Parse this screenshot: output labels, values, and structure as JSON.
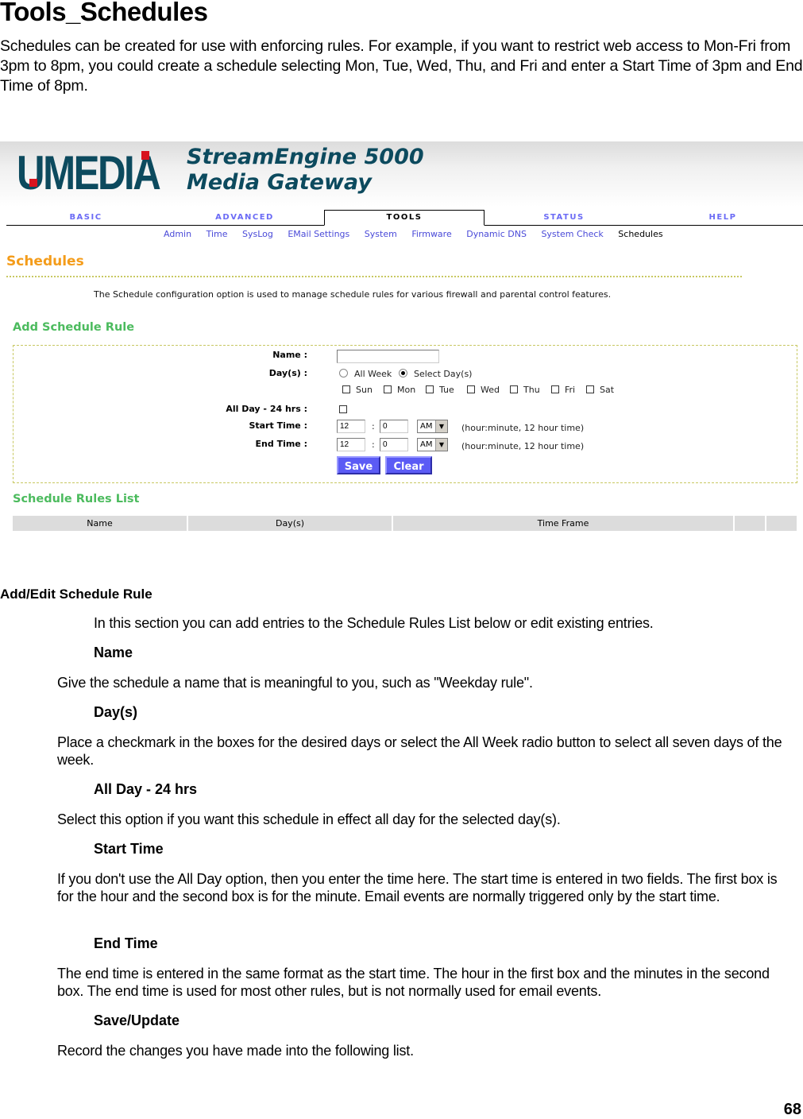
{
  "document": {
    "title": "Tools_Schedules",
    "intro": "Schedules can be created for use with enforcing rules. For example, if you want to restrict web access to Mon-Fri from 3pm to 8pm, you could create a schedule selecting Mon, Tue, Wed, Thu, and Fri and enter a Start Time of 3pm and End Time of 8pm.",
    "page_number": "68"
  },
  "ui": {
    "logo": "U·MEDiA",
    "product_line1": "StreamEngine 5000",
    "product_line2": "Media Gateway",
    "tabs": [
      {
        "label": "BASIC",
        "active": false
      },
      {
        "label": "ADVANCED",
        "active": false
      },
      {
        "label": "TOOLS",
        "active": true
      },
      {
        "label": "STATUS",
        "active": false
      },
      {
        "label": "HELP",
        "active": false
      }
    ],
    "subnav": [
      {
        "label": "Admin",
        "active": false
      },
      {
        "label": "Time",
        "active": false
      },
      {
        "label": "SysLog",
        "active": false
      },
      {
        "label": "EMail Settings",
        "active": false
      },
      {
        "label": "System",
        "active": false
      },
      {
        "label": "Firmware",
        "active": false
      },
      {
        "label": "Dynamic DNS",
        "active": false
      },
      {
        "label": "System Check",
        "active": false
      },
      {
        "label": "Schedules",
        "active": true
      }
    ],
    "page_heading": "Schedules",
    "page_description": "The Schedule configuration option is used to manage schedule rules for various firewall and parental control features.",
    "add_rule": {
      "heading": "Add Schedule Rule",
      "name_label": "Name :",
      "name_value": "",
      "days_label": "Day(s) :",
      "radio_all_week": "All Week",
      "radio_select_days": "Select Day(s)",
      "days_selection": "Select Day(s)",
      "days": [
        {
          "label": "Sun",
          "checked": false
        },
        {
          "label": "Mon",
          "checked": false
        },
        {
          "label": "Tue",
          "checked": false
        },
        {
          "label": "Wed",
          "checked": false
        },
        {
          "label": "Thu",
          "checked": false
        },
        {
          "label": "Fri",
          "checked": false
        },
        {
          "label": "Sat",
          "checked": false
        }
      ],
      "all_day_label": "All Day - 24 hrs :",
      "all_day_checked": false,
      "start_time_label": "Start Time :",
      "start_hour": "12",
      "start_minute": "0",
      "start_ampm": "AM",
      "end_time_label": "End Time :",
      "end_hour": "12",
      "end_minute": "0",
      "end_ampm": "AM",
      "colon": ":",
      "time_hint": "(hour:minute, 12 hour time)",
      "save_label": "Save",
      "clear_label": "Clear"
    },
    "rules_list": {
      "heading": "Schedule Rules List",
      "columns": [
        "Name",
        "Day(s)",
        "Time Frame",
        "",
        ""
      ]
    }
  },
  "help": {
    "heading": "Add/Edit Schedule Rule",
    "intro": "In this section you can add entries to the Schedule Rules List below or edit existing entries.",
    "items": [
      {
        "title": "Name",
        "text": "Give the schedule a name that is meaningful to you, such as \"Weekday rule\"."
      },
      {
        "title": "Day(s)",
        "text": "Place a checkmark in the boxes for the desired days or select the All Week radio button to select all seven days of the week."
      },
      {
        "title": "All Day - 24 hrs",
        "text": "Select this option if you want this schedule in effect all day for the selected day(s)."
      },
      {
        "title": "Start Time",
        "text": "If you don't use the All Day option, then you enter the time here. The start time is entered in two fields. The first box is for the hour and the second box is for the minute. Email events are normally triggered only by the start time."
      },
      {
        "title": "End Time",
        "text": "The end time is entered in the same format as the start time. The hour in the first box and the minutes in the second box. The end time is used for most other rules, but is not normally used for email events."
      },
      {
        "title": "Save/Update",
        "text": "Record the changes you have made into the following list."
      }
    ]
  },
  "colors": {
    "logo": "#0c4a5e",
    "logo_accent": "#d8131e",
    "tab_link": "#6b6bf5",
    "subnav_link": "#4a4ad8",
    "heading_orange": "#f49c1a",
    "heading_green": "#4cbb5e",
    "dotted_border": "#c8c862",
    "button": "#5b5bf5",
    "table_header": "#dcdcdc"
  }
}
